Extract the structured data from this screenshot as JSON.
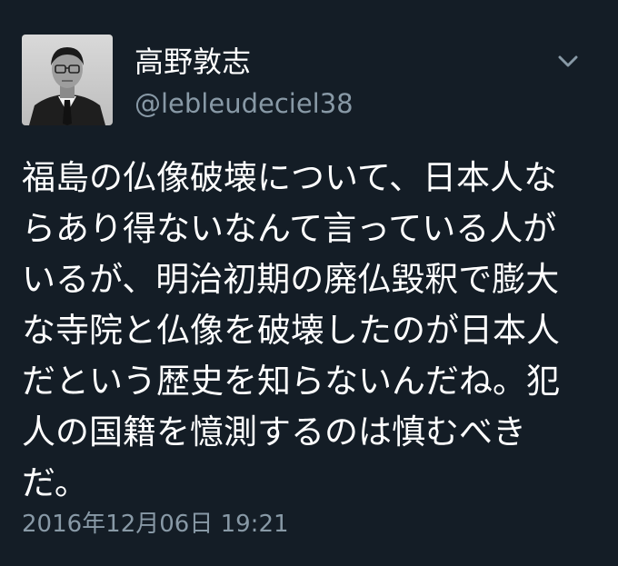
{
  "tweet": {
    "author": {
      "display_name": "高野敦志",
      "handle": "@lebleudeciel38",
      "avatar_icon": "profile-photo"
    },
    "menu_icon": "chevron-down-icon",
    "text_lines": [
      "福島の仏像破壊について、日本人な",
      "らあり得ないなんて言っている人が",
      "いるが、明治初期の廃仏毀釈で膨大",
      "な寺院と仏像を破壊したのが日本人",
      "だという歴史を知らないんだね。犯",
      "人の国籍を憶測するのは慎むべき",
      "だ。"
    ],
    "timestamp": "2016年12月06日 19:21"
  },
  "colors": {
    "background": "#141d26",
    "text_primary": "#ffffff",
    "text_secondary": "#8899a6"
  }
}
